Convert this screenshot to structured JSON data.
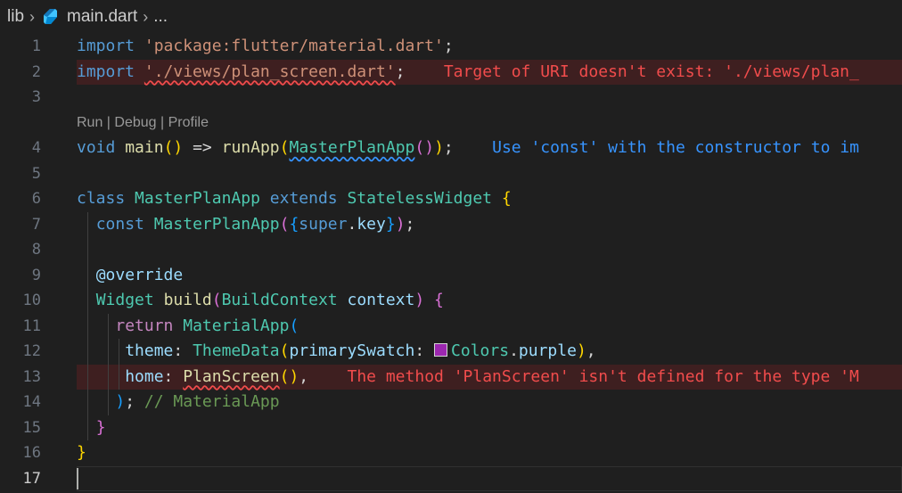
{
  "breadcrumb": {
    "folder": "lib",
    "file": "main.dart",
    "ellipsis": "..."
  },
  "icons": {
    "chevron": "chevron-right-icon",
    "dart": "dart-file-icon"
  },
  "colors": {
    "background": "#1f1f1f",
    "error": "#f14c4c",
    "info": "#3794ff",
    "swatch": "#9c27b0"
  },
  "codelens": {
    "run": "Run",
    "debug": "Debug",
    "profile": "Profile",
    "divider": " | "
  },
  "lines": {
    "n1": "1",
    "n2": "2",
    "n3": "3",
    "n4": "4",
    "n5": "5",
    "n6": "6",
    "n7": "7",
    "n8": "8",
    "n9": "9",
    "n10": "10",
    "n11": "11",
    "n12": "12",
    "n13": "13",
    "n14": "14",
    "n15": "15",
    "n16": "16",
    "n17": "17"
  },
  "code": {
    "import_kw": "import",
    "import1_str": "'package:flutter/material.dart'",
    "semicolon": ";",
    "import2_str": "'./views/plan_screen.dart'",
    "void_kw": "void",
    "main_fn": "main",
    "arrow": " => ",
    "runapp_fn": "runApp",
    "masterplan_ctor": "MasterPlanApp",
    "class_kw": "class",
    "class_name": "MasterPlanApp",
    "extends_kw": "extends",
    "stateless": "StatelessWidget",
    "const_kw": "const",
    "ctor_name": "MasterPlanApp",
    "super_kw": "super",
    "key_prop": "key",
    "override": "@override",
    "widget_type": "Widget",
    "build_fn": "build",
    "buildcontext": "BuildContext",
    "context_param": "context",
    "return_kw": "return",
    "materialapp": "MaterialApp",
    "theme_prop": "theme",
    "themedata": "ThemeData",
    "primaryswatch": "primarySwatch",
    "colors_cls": "Colors",
    "purple_prop": "purple",
    "home_prop": "home",
    "planscreen": "PlanScreen",
    "comment14": "// MaterialApp"
  },
  "diagnostics": {
    "line2": "Target of URI doesn't exist: './views/plan_",
    "line4": "Use 'const' with the constructor to im",
    "line13": "The method 'PlanScreen' isn't defined for the type 'M"
  }
}
